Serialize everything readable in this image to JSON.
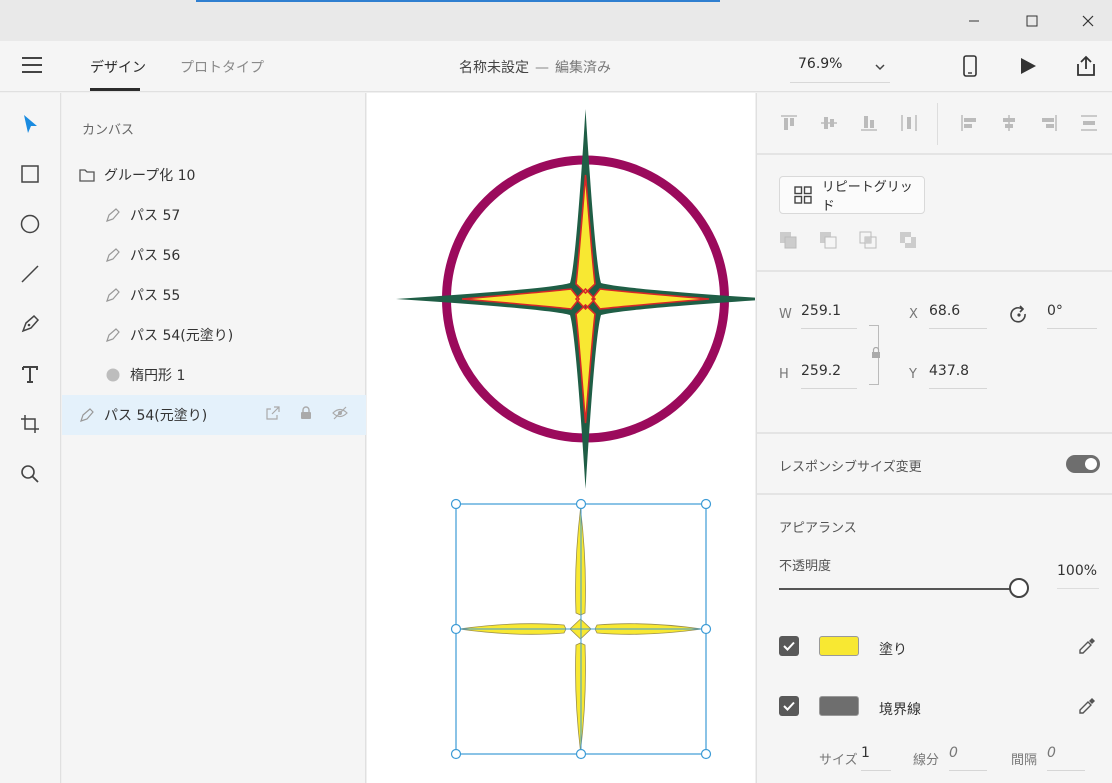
{
  "window": {
    "minimize_glyph": "—",
    "maximize_glyph": "☐",
    "close_glyph": "✕"
  },
  "appbar": {
    "tabs": [
      {
        "label": "デザイン",
        "active": true
      },
      {
        "label": "プロトタイプ",
        "active": false
      }
    ],
    "doc_title": "名称未設定",
    "doc_separator": "—",
    "doc_status": "編集済み",
    "zoom": "76.9%"
  },
  "layers": {
    "title": "カンバス",
    "items": [
      {
        "label": "グループ化 10",
        "icon": "folder-icon",
        "indent": 0
      },
      {
        "label": "パス 57",
        "icon": "pen-icon",
        "indent": 1
      },
      {
        "label": "パス 56",
        "icon": "pen-icon",
        "indent": 1
      },
      {
        "label": "パス 55",
        "icon": "pen-icon",
        "indent": 1
      },
      {
        "label": "パス 54(元塗り)",
        "icon": "pen-icon",
        "indent": 1
      },
      {
        "label": "楕円形 1",
        "icon": "ellipse-icon",
        "indent": 1
      },
      {
        "label": "パス 54(元塗り)",
        "icon": "pen-icon",
        "indent": 0,
        "selected": true
      }
    ]
  },
  "properties": {
    "repeat_grid_label": "リピートグリッド",
    "w_label": "W",
    "w_value": "259.1",
    "h_label": "H",
    "h_value": "259.2",
    "x_label": "X",
    "x_value": "68.6",
    "y_label": "Y",
    "y_value": "437.8",
    "rotation_value": "0°",
    "responsive_label": "レスポンシブサイズ変更",
    "appearance_label": "アピアランス",
    "opacity_label": "不透明度",
    "opacity_value": "100%",
    "opacity_fraction": 1.0,
    "fill_label": "塗り",
    "fill_color": "#f8e832",
    "border_label": "境界線",
    "border_color": "#6e6e6e",
    "size_label": "サイズ",
    "size_value": "1",
    "dash_label": "線分",
    "dash_value": "0",
    "gap_label": "間隔",
    "gap_value": "0"
  },
  "colors": {
    "ring": "#9b0a5c",
    "star_outline": "#1f5e46",
    "star_inner_stroke": "#d62828",
    "star_fill": "#f8e832",
    "selection": "#3c9bd6"
  }
}
